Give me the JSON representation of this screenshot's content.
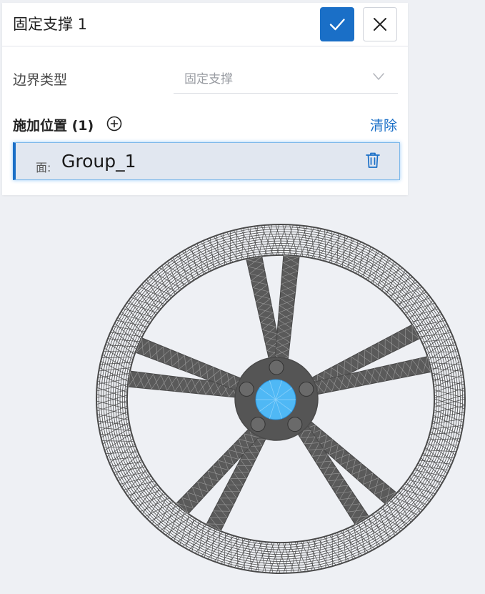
{
  "panel": {
    "title": "固定支撑 1",
    "confirm_icon": "check-icon",
    "close_icon": "close-icon",
    "boundary_type": {
      "label": "边界类型",
      "value": "固定支撑"
    },
    "location": {
      "title": "施加位置 (1)",
      "clear_label": "清除",
      "items": [
        {
          "prefix": "面:",
          "name": "Group_1"
        }
      ]
    }
  },
  "colors": {
    "accent": "#1a6fc7",
    "selection_bg": "#e1e7f0",
    "mesh": "#4a4a4a",
    "highlight_face": "#4fb8f5",
    "viewport_bg": "#eef0f4"
  }
}
